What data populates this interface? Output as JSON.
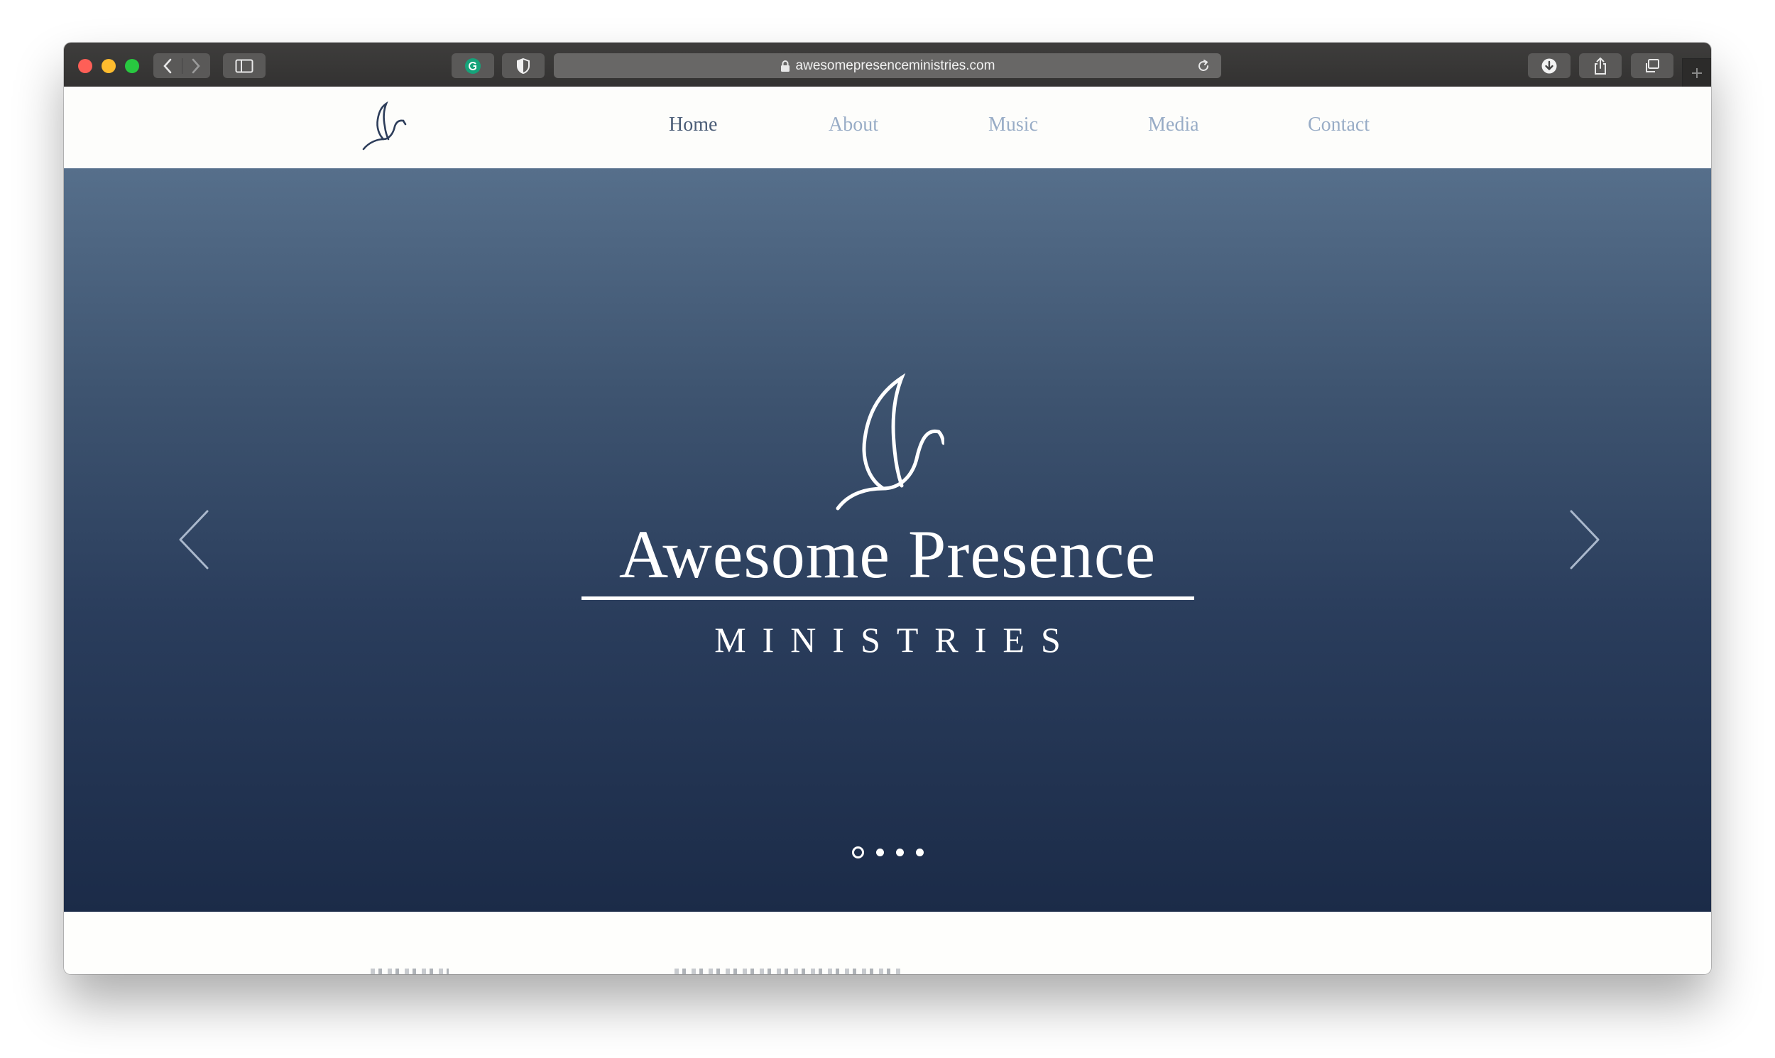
{
  "browser": {
    "url": "awesomepresenceministries.com"
  },
  "nav": {
    "items": [
      {
        "label": "Home",
        "active": true
      },
      {
        "label": "About",
        "active": false
      },
      {
        "label": "Music",
        "active": false
      },
      {
        "label": "Media",
        "active": false
      },
      {
        "label": "Contact",
        "active": false
      }
    ]
  },
  "hero": {
    "title": "Awesome Presence",
    "subtitle": "MINISTRIES",
    "slides_total": 4,
    "active_slide": 1
  },
  "icons": {
    "logo": "dove-icon",
    "prev": "chevron-left-icon",
    "next": "chevron-right-icon"
  },
  "colors": {
    "nav_active": "#4b5d77",
    "nav_inactive": "#98acc6",
    "hero_top": "#566f8b",
    "hero_bottom": "#1b2b48"
  }
}
